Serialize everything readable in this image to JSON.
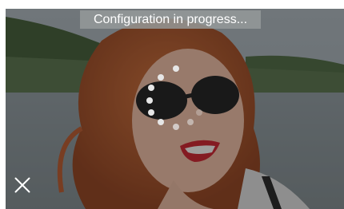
{
  "overlay": {
    "status_text": "Configuration in progress...",
    "spinner_icon": "loading-spinner-icon",
    "close_icon": "close-icon"
  },
  "colors": {
    "banner_bg": "#969b9b",
    "spinner_dot": "#e6e6e6",
    "icon": "#ffffff"
  }
}
